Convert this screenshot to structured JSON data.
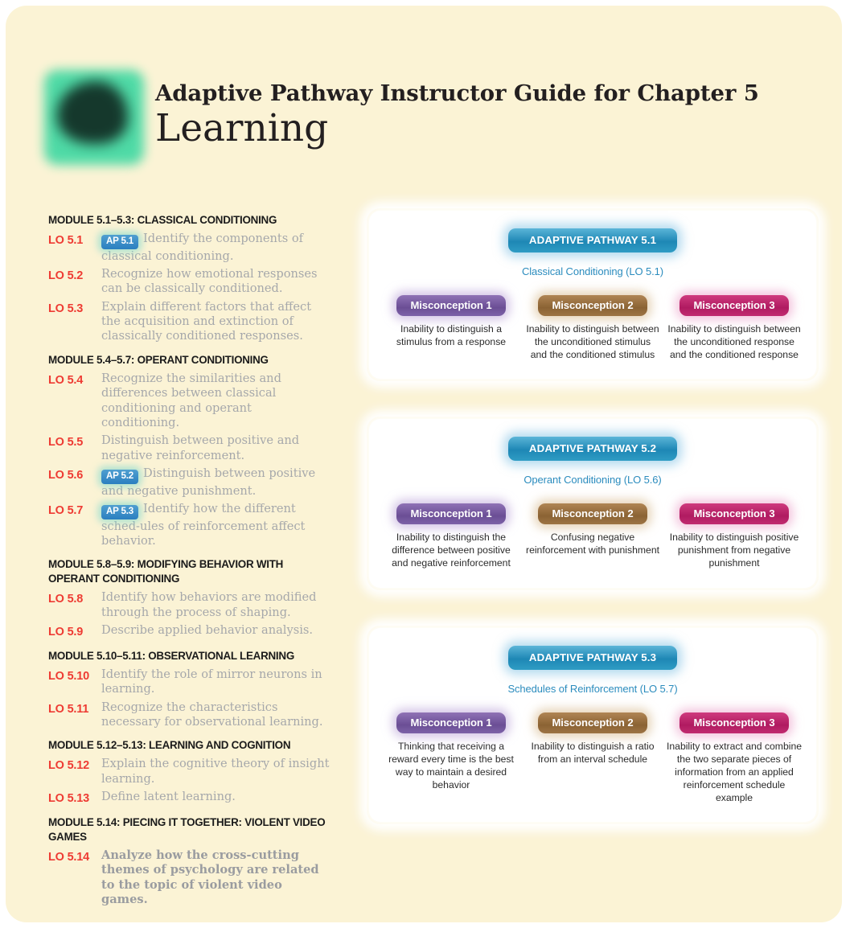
{
  "header": {
    "logo_icon": "brain-logo-icon",
    "guide_title": "Adaptive Pathway Instructor Guide for Chapter 5",
    "chapter_title": "Learning"
  },
  "objectives": {
    "modules": [
      {
        "heading": "MODULE 5.1–5.3: CLASSICAL CONDITIONING",
        "items": [
          {
            "tag": "LO 5.1",
            "ap_badge": "AP 5.1",
            "text": "Identify the components of classical conditioning.",
            "bold": false
          },
          {
            "tag": "LO 5.2",
            "ap_badge": "",
            "text": "Recognize how emotional responses can be classically conditioned.",
            "bold": false
          },
          {
            "tag": "LO 5.3",
            "ap_badge": "",
            "text": "Explain different factors that affect the acquisition and extinction of classically conditioned responses.",
            "bold": false
          }
        ]
      },
      {
        "heading": "MODULE 5.4–5.7: OPERANT CONDITIONING",
        "items": [
          {
            "tag": "LO 5.4",
            "ap_badge": "",
            "text": "Recognize the similarities and differences between classical conditioning and operant conditioning.",
            "bold": false
          },
          {
            "tag": "LO 5.5",
            "ap_badge": "",
            "text": "Distinguish between positive and negative reinforcement.",
            "bold": false
          },
          {
            "tag": "LO 5.6",
            "ap_badge": "AP 5.2",
            "text": "Distinguish between positive and negative punishment.",
            "bold": false
          },
          {
            "tag": "LO 5.7",
            "ap_badge": "AP 5.3",
            "text": "Identify how the different sched-ules of reinforcement affect behavior.",
            "bold": false
          }
        ]
      },
      {
        "heading": "MODULE 5.8–5.9: MODIFYING BEHAVIOR WITH OPERANT CONDITIONING",
        "items": [
          {
            "tag": "LO 5.8",
            "ap_badge": "",
            "text": "Identify how behaviors are modified through the process of shaping.",
            "bold": false
          },
          {
            "tag": "LO 5.9",
            "ap_badge": "",
            "text": "Describe applied behavior analysis.",
            "bold": false
          }
        ]
      },
      {
        "heading": "MODULE 5.10–5.11: OBSERVATIONAL LEARNING",
        "items": [
          {
            "tag": "LO 5.10",
            "ap_badge": "",
            "text": "Identify the role of mirror neurons in learning.",
            "bold": false
          },
          {
            "tag": "LO 5.11",
            "ap_badge": "",
            "text": "Recognize the characteristics necessary for observational learning.",
            "bold": false
          }
        ]
      },
      {
        "heading": "MODULE 5.12–5.13: LEARNING AND COGNITION",
        "items": [
          {
            "tag": "LO 5.12",
            "ap_badge": "",
            "text": "Explain the cognitive theory of insight learning.",
            "bold": false
          },
          {
            "tag": "LO 5.13",
            "ap_badge": "",
            "text": "Define latent learning.",
            "bold": false
          }
        ]
      },
      {
        "heading": "MODULE 5.14: PIECING IT TOGETHER: VIOLENT VIDEO GAMES",
        "items": [
          {
            "tag": "LO 5.14",
            "ap_badge": "",
            "text": "Analyze how the cross-cutting themes of psychology are related to the topic of violent video games.",
            "bold": true
          }
        ]
      }
    ]
  },
  "pathways": [
    {
      "pill": "ADAPTIVE PATHWAY 5.1",
      "subtitle": "Classical Conditioning (LO 5.1)",
      "misconceptions": [
        {
          "label": "Misconception 1",
          "text": "Inability to distinguish a stimulus from a response"
        },
        {
          "label": "Misconception 2",
          "text": "Inability to distinguish between the unconditioned stimulus and the conditioned stimulus"
        },
        {
          "label": "Misconception 3",
          "text": "Inability to distinguish between the unconditioned response and the conditioned response"
        }
      ]
    },
    {
      "pill": "ADAPTIVE PATHWAY 5.2",
      "subtitle": "Operant Conditioning (LO 5.6)",
      "misconceptions": [
        {
          "label": "Misconception 1",
          "text": "Inability to distinguish the difference between positive and negative reinforcement"
        },
        {
          "label": "Misconception 2",
          "text": "Confusing negative reinforcement with punishment"
        },
        {
          "label": "Misconception 3",
          "text": "Inability to distinguish positive punishment from negative punishment"
        }
      ]
    },
    {
      "pill": "ADAPTIVE PATHWAY 5.3",
      "subtitle": "Schedules of Reinforcement (LO 5.7)",
      "misconceptions": [
        {
          "label": "Misconception 1",
          "text": "Thinking that receiving a reward every time is the best way to maintain a desired behavior"
        },
        {
          "label": "Misconception 2",
          "text": "Inability to distinguish a ratio from an interval schedule"
        },
        {
          "label": "Misconception 3",
          "text": "Inability to extract and combine the two separate pieces of information from an applied reinforcement schedule example"
        }
      ]
    }
  ],
  "colors": {
    "page_background": "#fbf3d5",
    "lo_tag": "#ee3b33",
    "module_heading": "#1b1b1b",
    "objective_text": "#a6a8ab",
    "pathway_pill": "#1e87b5",
    "pathway_subtitle": "#2b8cbe",
    "misconception_1": "#6b4e95",
    "misconception_2": "#8b6334",
    "misconception_3": "#b01b61",
    "ap_badge": "#2b7fc0",
    "logo_green": "#46d9a4"
  }
}
